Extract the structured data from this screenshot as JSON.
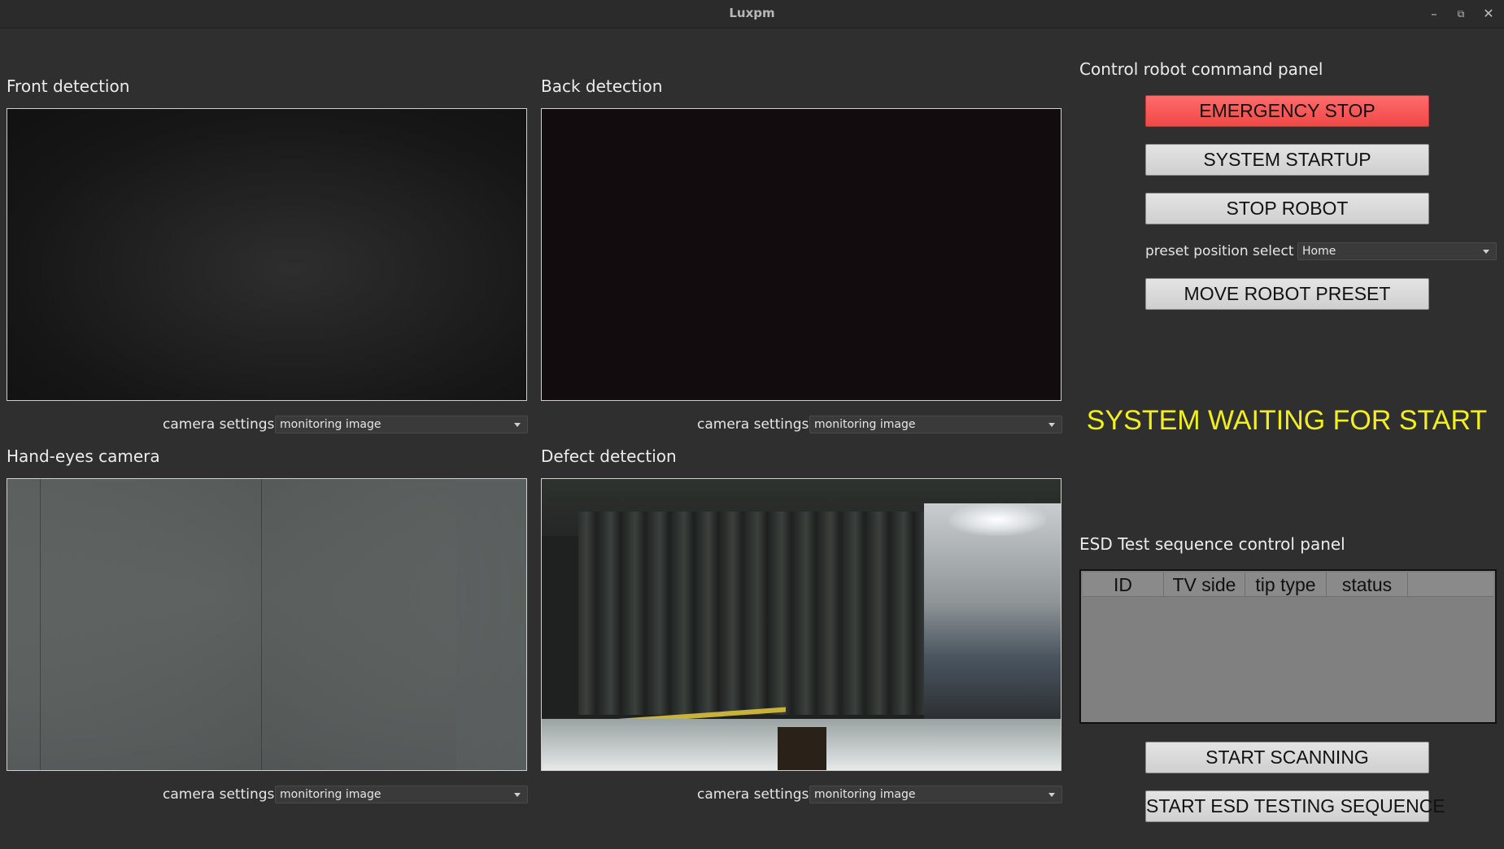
{
  "window": {
    "title": "Luxpm",
    "controls": [
      "minimize-icon",
      "maximize-icon",
      "close-icon"
    ]
  },
  "cameras": {
    "front": {
      "label": "Front detection",
      "settings_label": "camera settings",
      "mode": "monitoring image"
    },
    "back": {
      "label": "Back detection",
      "settings_label": "camera settings",
      "mode": "monitoring image"
    },
    "hand": {
      "label": "Hand-eyes camera",
      "settings_label": "camera settings",
      "mode": "monitoring image"
    },
    "defect": {
      "label": "Defect detection",
      "settings_label": "camera settings",
      "mode": "monitoring image"
    }
  },
  "control_panel": {
    "title": "Control robot command panel",
    "emergency_stop": "EMERGENCY STOP",
    "system_startup": "SYSTEM STARTUP",
    "stop_robot": "STOP ROBOT",
    "preset_label": "preset position select",
    "preset_value": "Home",
    "move_preset": "MOVE ROBOT PRESET",
    "status": "SYSTEM WAITING FOR START",
    "emergency_color": "#f04848",
    "status_color": "#f2ef1f"
  },
  "esd_panel": {
    "title": "ESD Test sequence control panel",
    "columns": [
      "ID",
      "TV side",
      "tip type",
      "status"
    ],
    "rows": [],
    "start_scanning": "START SCANNING",
    "start_esd": "START ESD TESTING SEQUENCE"
  }
}
